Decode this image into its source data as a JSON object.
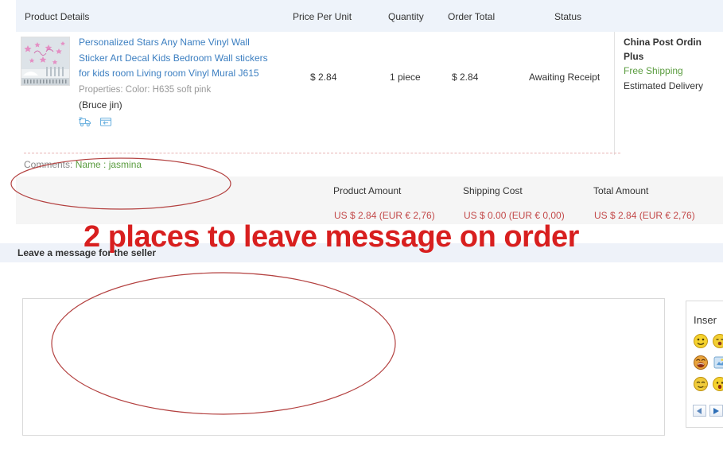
{
  "table": {
    "headers": {
      "product": "Product Details",
      "price": "Price Per Unit",
      "quantity": "Quantity",
      "order_total": "Order Total",
      "status": "Status"
    }
  },
  "product": {
    "title": "Personalized Stars Any Name Vinyl Wall Sticker Art Decal Kids Bedroom Wall stickers for kids room Living room Vinyl Mural J615",
    "properties": "Properties: Color: H635 soft pink",
    "seller": "(Bruce jin)",
    "price_per_unit": "$ 2.84",
    "quantity": "1 piece",
    "order_total": "$ 2.84",
    "status": "Awaiting Receipt",
    "icons": {
      "shipping": "truck-icon",
      "returns": "return-box-icon"
    }
  },
  "shipping": {
    "method": "China Post Ordin",
    "method_line2": "Plus",
    "free_shipping": "Free Shipping",
    "estimated_delivery": "Estimated Delivery"
  },
  "comments": {
    "label": "Comments:",
    "value": "Name : jasmina"
  },
  "totals": {
    "columns": [
      {
        "label": "Product Amount",
        "value": "US $ 2.84 (EUR € 2,76)"
      },
      {
        "label": "Shipping Cost",
        "value": "US $ 0.00 (EUR € 0,00)"
      },
      {
        "label": "Total Amount",
        "value": "US $ 2.84 (EUR € 2,76)"
      }
    ]
  },
  "message_section": {
    "bar_label": "Leave a message for the seller",
    "textarea_value": "",
    "textarea_placeholder": ""
  },
  "emoji_panel": {
    "title": "Inser",
    "emojis": [
      "smile-emoji",
      "emoji-b",
      "emoji-c",
      "laugh-emoji",
      "emoji-e",
      "emoji-f",
      "smirk-emoji",
      "emoji-h",
      "emoji-i"
    ],
    "prev_label": "◀",
    "next_label": "▶"
  },
  "annotation": {
    "text": "2 places to leave message on order",
    "color": "#d81f1f"
  },
  "colors": {
    "header_bg": "#eef3fa",
    "link": "#3c7fc1",
    "green": "#5a9c3f",
    "amount_red": "#c34a4a",
    "totals_bg": "#f5f5f5",
    "message_bar_bg": "#eef2f9",
    "annotation_red": "#d81f1f"
  }
}
